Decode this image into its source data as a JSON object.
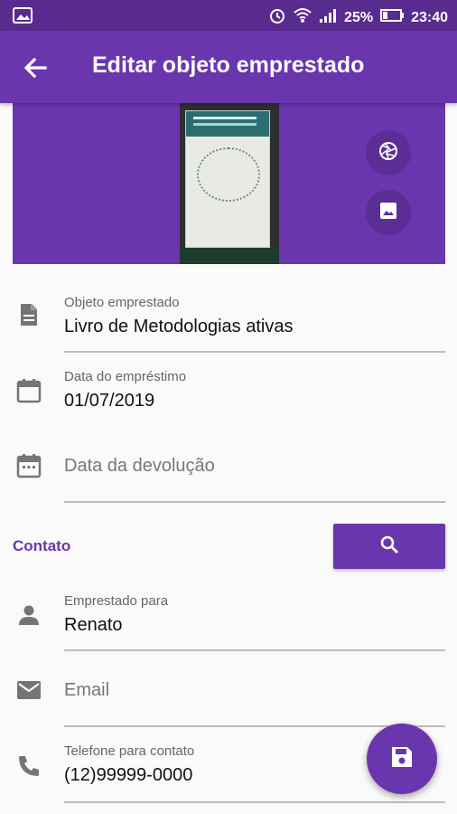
{
  "status_bar": {
    "battery": "25%",
    "time": "23:40",
    "icons": [
      "image-icon",
      "alarm-icon",
      "wifi-icon",
      "signal-icon",
      "battery-icon"
    ]
  },
  "app_bar": {
    "title": "Editar objeto emprestado",
    "back_icon": "arrow-back-icon"
  },
  "photo_actions": {
    "camera_icon": "camera-aperture-icon",
    "gallery_icon": "image-icon"
  },
  "fields": {
    "objeto": {
      "label": "Objeto emprestado",
      "value": "Livro de Metodologias ativas",
      "icon": "document-icon"
    },
    "data_emprestimo": {
      "label": "Data do empréstimo",
      "value": "01/07/2019",
      "icon": "calendar-icon"
    },
    "data_devolucao": {
      "placeholder": "Data da devolução",
      "icon": "calendar-icon"
    },
    "emprestado_para": {
      "label": "Emprestado para",
      "value": "Renato",
      "icon": "person-icon"
    },
    "email": {
      "placeholder": "Email",
      "icon": "email-icon"
    },
    "telefone": {
      "label": "Telefone para contato",
      "value": "(12)99999-0000",
      "icon": "phone-icon"
    }
  },
  "contato": {
    "heading": "Contato",
    "search_icon": "search-icon"
  },
  "fab": {
    "icon": "save-icon"
  },
  "colors": {
    "primary": "#6a36ad",
    "primary_dark": "#5a2b8f",
    "background": "#fafafa"
  }
}
